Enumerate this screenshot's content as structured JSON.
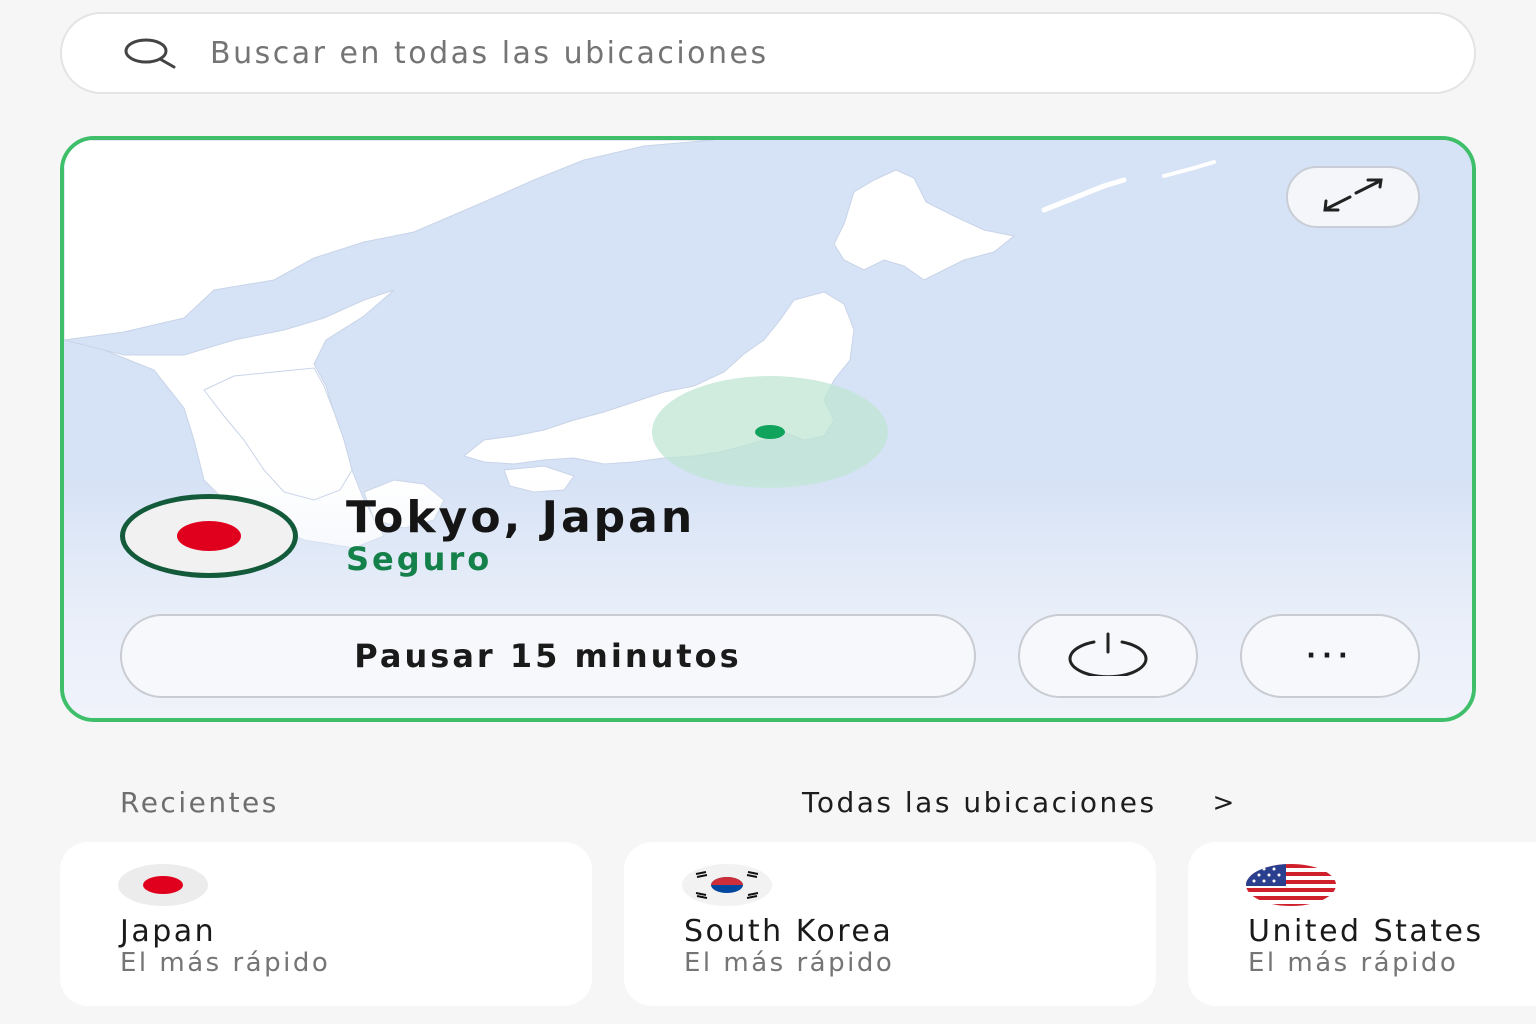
{
  "search": {
    "placeholder": "Buscar en todas las ubicaciones",
    "icon": "search-icon"
  },
  "connection": {
    "location": "Tokyo, Japan",
    "status": "Seguro",
    "status_color": "#14804a",
    "border_color": "#3fbf6a",
    "flag": "japan-flag",
    "map_region": "Japan / East Asia",
    "expand_icon": "expand-icon",
    "pause_label": "Pausar 15 minutos",
    "power_icon": "power-icon",
    "more_label": "···"
  },
  "recents": {
    "title": "Recientes",
    "all_locations_label": "Todas las ubicaciones",
    "chevron": ">",
    "items": [
      {
        "name": "Japan",
        "subtitle": "El más rápido",
        "flag": "japan-flag"
      },
      {
        "name": "South Korea",
        "subtitle": "El más rápido",
        "flag": "south-korea-flag"
      },
      {
        "name": "United States",
        "subtitle": "El más rápido",
        "flag": "united-states-flag"
      }
    ]
  }
}
